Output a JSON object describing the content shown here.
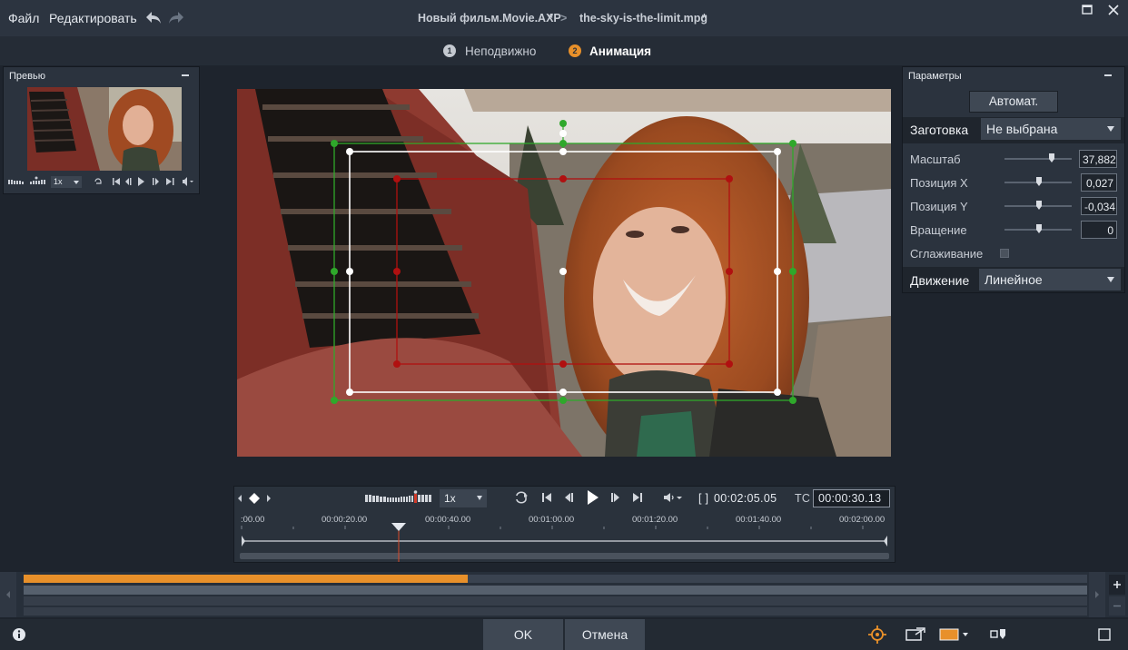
{
  "menu": {
    "file": "Файл",
    "edit": "Редактировать"
  },
  "title": {
    "project": "Новый фильм.Movie.AXP",
    "project_mod": "*",
    "separator": ">",
    "clip": "the-sky-is-the-limit.mpg",
    "clip_mod": "*"
  },
  "steps": [
    {
      "num": "1",
      "label": "Неподвижно",
      "active": false
    },
    {
      "num": "2",
      "label": "Анимация",
      "active": true
    }
  ],
  "preview_panel": {
    "title": "Превью",
    "speed": "1x"
  },
  "params": {
    "title": "Параметры",
    "auto_button": "Автомат.",
    "preset_label": "Заготовка",
    "preset_value": "Не выбрана",
    "scale_label": "Масштаб",
    "scale_value": "37,882",
    "posx_label": "Позиция X",
    "posx_value": "0,027",
    "posy_label": "Позиция Y",
    "posy_value": "-0,034",
    "rotation_label": "Вращение",
    "rotation_value": "0",
    "smoothing_label": "Сглаживание",
    "motion_label": "Движение",
    "motion_value": "Линейное"
  },
  "transport": {
    "speed": "1x",
    "duration_prefix": "[ ]",
    "duration": "00:02:05.05",
    "tc_label": "TC",
    "timecode": "00:00:30.13",
    "ruler": [
      ":00.00",
      "00:00:20.00",
      "00:00:40.00",
      "00:01:00.00",
      "00:01:20.00",
      "00:01:40.00",
      "00:02:00.00"
    ]
  },
  "bottom": {
    "ok": "OK",
    "cancel": "Отмена"
  },
  "colors": {
    "accent": "#e8902a",
    "green_frame": "#2fa82b",
    "red_frame": "#b01010",
    "white_frame": "#ffffff"
  }
}
